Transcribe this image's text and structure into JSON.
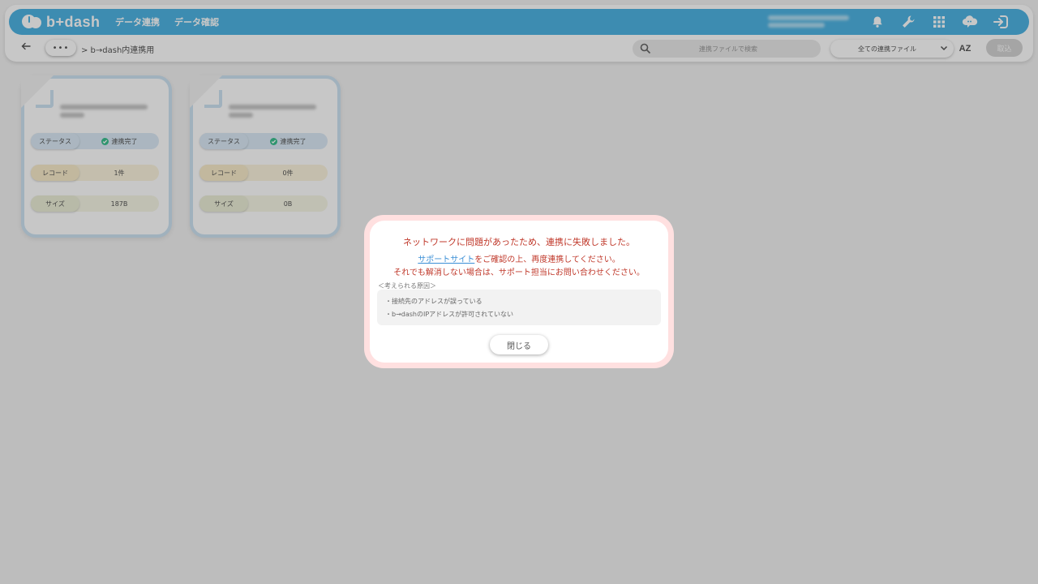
{
  "header": {
    "logo_text": "b+dash",
    "nav": [
      "データ連携",
      "データ確認"
    ],
    "icons": [
      "bell-icon",
      "wrench-icon",
      "apps-grid-icon",
      "chat-cloud-icon",
      "logout-icon"
    ]
  },
  "toolbar": {
    "more_label": "•••",
    "breadcrumb": "> b→dash内連携用",
    "search_placeholder": "連携ファイルで検索",
    "filter_value": "全ての連携ファイル",
    "sort_label": "AZ",
    "cancel_label": "取込"
  },
  "cards": [
    {
      "status_label": "ステータス",
      "status_value": "連携完了",
      "record_label": "レコード",
      "record_value": "1件",
      "size_label": "サイズ",
      "size_value": "187B"
    },
    {
      "status_label": "ステータス",
      "status_value": "連携完了",
      "record_label": "レコード",
      "record_value": "0件",
      "size_label": "サイズ",
      "size_value": "0B"
    }
  ],
  "dialog": {
    "title": "ネットワークに問題があったため、連携に失敗しました。",
    "link_text": "サポートサイト",
    "msg1_rest": "をご確認の上、再度連携してください。",
    "msg2": "それでも解消しない場合は、サポート担当にお問い合わせください。",
    "cause_title": "＜考えられる原因＞",
    "causes": [
      "・接続先のアドレスが誤っている",
      "・b→dashのIPアドレスが許可されていない"
    ],
    "close_label": "閉じる"
  },
  "colors": {
    "brand": "#4fb4e3",
    "error": "#c0392b",
    "link": "#3b8fd6"
  }
}
